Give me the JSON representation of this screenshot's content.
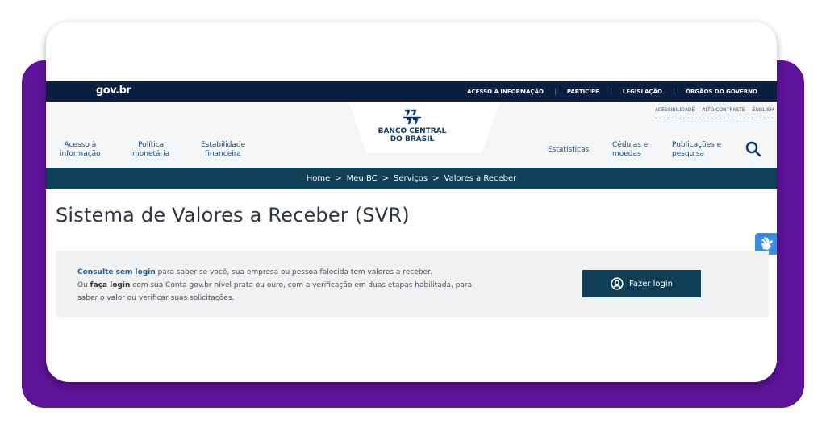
{
  "govbar": {
    "logo": "gov.br",
    "links": [
      "ACESSO À INFORMAÇÃO",
      "PARTICIPE",
      "LEGISLAÇÃO",
      "ÓRGÃOS DO GOVERNO"
    ]
  },
  "header": {
    "logo_line1": "BANCO CENTRAL",
    "logo_line2": "DO BRASIL",
    "access": {
      "accessibility": "ACESSIBILIDADE",
      "contrast": "ALTO CONTRASTE",
      "english": "ENGLISH"
    },
    "nav_left": [
      {
        "line1": "Acesso à",
        "line2": "informação"
      },
      {
        "line1": "Política",
        "line2": "monetária"
      },
      {
        "line1": "Estabilidade",
        "line2": "financeira"
      }
    ],
    "nav_right": [
      {
        "line1": "Estatísticas",
        "line2": ""
      },
      {
        "line1": "Cédulas e",
        "line2": "moedas"
      },
      {
        "line1": "Publicações e",
        "line2": "pesquisa"
      }
    ]
  },
  "breadcrumb": [
    "Home",
    "Meu BC",
    "Serviços",
    "Valores a Receber"
  ],
  "breadcrumb_separator": ">",
  "page": {
    "title": "Sistema de Valores a Receber (SVR)"
  },
  "info": {
    "consult_link": "Consulte sem login",
    "line1_rest": " para saber se você, sua empresa ou pessoa falecida tem valores a receber.",
    "line2_prefix": "Ou ",
    "login_strong": "faça login",
    "line2_rest": " com sua Conta gov.br nível prata ou ouro, com a verificação em duas etapas habilitada, para",
    "line3": "saber o valor ou verificar suas solicitações.",
    "button_label": "Fazer login"
  },
  "colors": {
    "purple_frame": "#5e139a",
    "govbar": "#0b2040",
    "breadcrumb_bar": "#103f58",
    "login_button": "#0f3e56",
    "link": "#1b5fa0",
    "libras_button": "#3c8de0"
  },
  "icons": {
    "search": "search-icon",
    "user": "user-circle-icon",
    "libras": "sign-language-icon",
    "bc_logo": "banco-central-logo-icon"
  }
}
